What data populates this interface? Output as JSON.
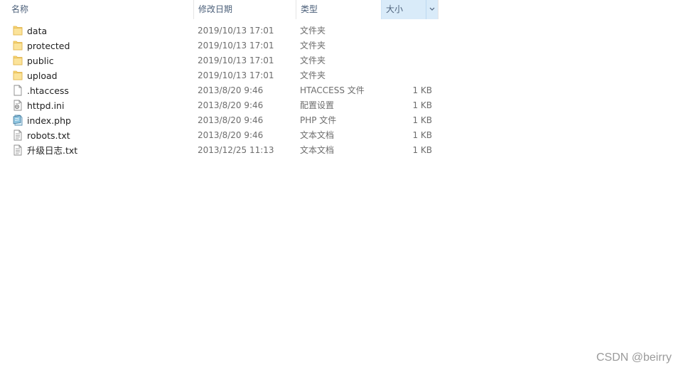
{
  "columns": {
    "name": "名称",
    "date": "修改日期",
    "type": "类型",
    "size": "大小"
  },
  "sort": {
    "column": "name",
    "direction": "ascending"
  },
  "files": [
    {
      "name": "data",
      "date": "2019/10/13 17:01",
      "type": "文件夹",
      "size": "",
      "icon": "folder-icon"
    },
    {
      "name": "protected",
      "date": "2019/10/13 17:01",
      "type": "文件夹",
      "size": "",
      "icon": "folder-icon"
    },
    {
      "name": "public",
      "date": "2019/10/13 17:01",
      "type": "文件夹",
      "size": "",
      "icon": "folder-icon"
    },
    {
      "name": "upload",
      "date": "2019/10/13 17:01",
      "type": "文件夹",
      "size": "",
      "icon": "folder-icon"
    },
    {
      "name": ".htaccess",
      "date": "2013/8/20 9:46",
      "type": "HTACCESS 文件",
      "size": "1 KB",
      "icon": "blank-file-icon"
    },
    {
      "name": "httpd.ini",
      "date": "2013/8/20 9:46",
      "type": "配置设置",
      "size": "1 KB",
      "icon": "config-file-icon"
    },
    {
      "name": "index.php",
      "date": "2013/8/20 9:46",
      "type": "PHP 文件",
      "size": "1 KB",
      "icon": "php-file-icon"
    },
    {
      "name": "robots.txt",
      "date": "2013/8/20 9:46",
      "type": "文本文档",
      "size": "1 KB",
      "icon": "text-file-icon"
    },
    {
      "name": "升级日志.txt",
      "date": "2013/12/25 11:13",
      "type": "文本文档",
      "size": "1 KB",
      "icon": "text-file-icon"
    }
  ],
  "colors": {
    "header_text": "#4c607a",
    "active_column_bg": "#d9ebf9",
    "folder": "#f8d775",
    "muted_text": "#6d6d6d"
  },
  "watermark": "CSDN @beirry"
}
